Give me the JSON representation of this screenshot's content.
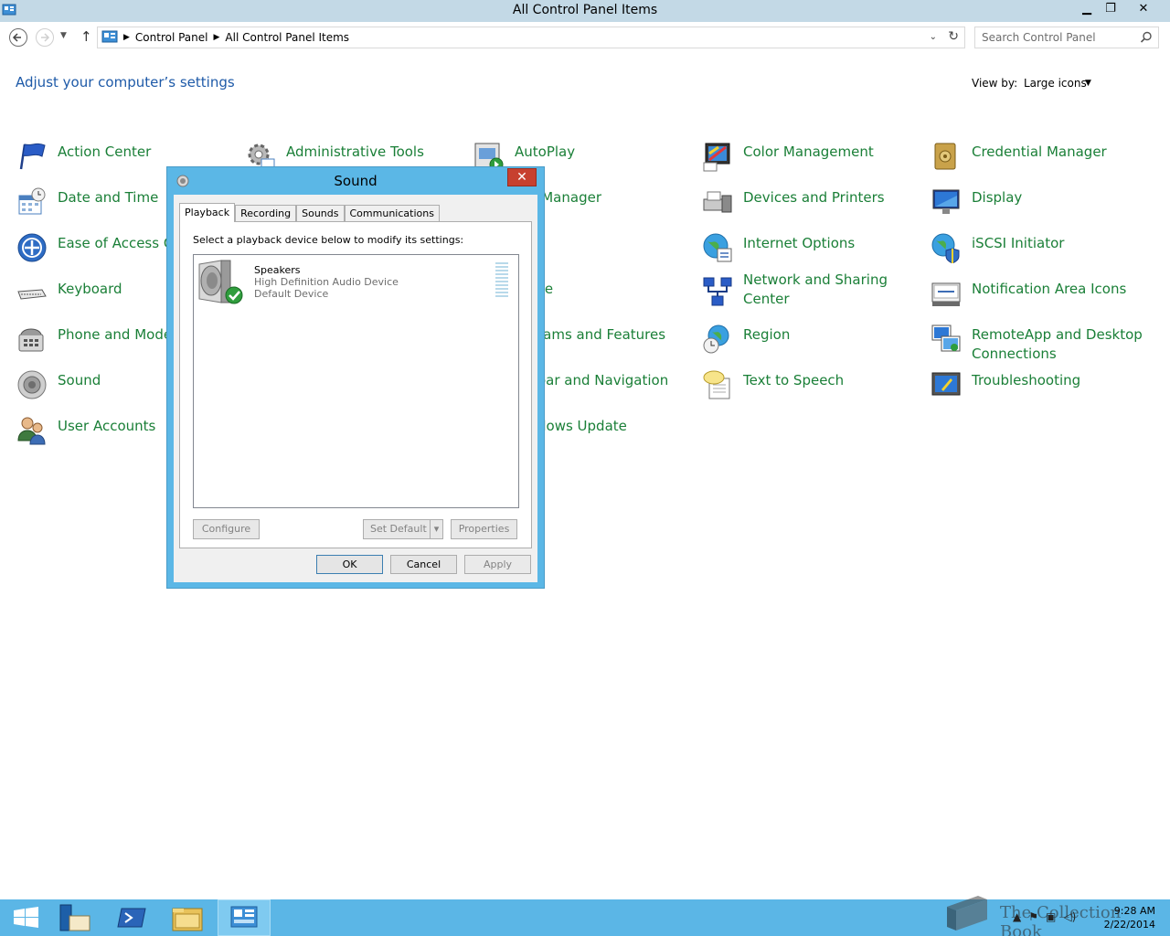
{
  "window": {
    "title": "All Control Panel Items",
    "controls": {
      "minimize": "▁",
      "restore": "❐",
      "close": "✕"
    }
  },
  "address": {
    "crumbs": [
      "Control Panel",
      "All Control Panel Items"
    ],
    "search_placeholder": "Search Control Panel"
  },
  "header": {
    "title": "Adjust your computer’s settings",
    "view_by_label": "View by:",
    "view_by_value": "Large icons"
  },
  "items": {
    "action_center": "Action Center",
    "administrative_tools": "Administrative Tools",
    "autoplay": "AutoPlay",
    "color_management": "Color Management",
    "credential_manager": "Credential Manager",
    "date_and_time": "Date and Time",
    "device_manager_partial": "ce Manager",
    "devices_and_printers": "Devices and Printers",
    "display": "Display",
    "ease_of_access_partial": "Ease of Access Ce",
    "fonts_partial": "s",
    "internet_options": "Internet Options",
    "iscsi_initiator": "iSCSI Initiator",
    "keyboard": "Keyboard",
    "mouse_partial": "se",
    "network_and_sharing": "Network and Sharing Center",
    "notification_area_icons": "Notification Area Icons",
    "phone_and_modem_partial": "Phone and Modem",
    "programs_partial": "rams and Features",
    "region": "Region",
    "remoteapp": "RemoteApp and Desktop Connections",
    "sound": "Sound",
    "taskbar_partial": "oar and Navigation",
    "text_to_speech": "Text to Speech",
    "troubleshooting": "Troubleshooting",
    "user_accounts": "User Accounts",
    "windows_update_partial": "dows Update"
  },
  "sound_dialog": {
    "title": "Sound",
    "tabs": [
      "Playback",
      "Recording",
      "Sounds",
      "Communications"
    ],
    "instruction": "Select a playback device below to modify its settings:",
    "device": {
      "name": "Speakers",
      "description": "High Definition Audio Device",
      "status": "Default Device"
    },
    "buttons": {
      "configure": "Configure",
      "set_default": "Set Default",
      "properties": "Properties",
      "ok": "OK",
      "cancel": "Cancel",
      "apply": "Apply"
    }
  },
  "taskbar": {
    "time": "9:28 AM",
    "date": "2/22/2014"
  },
  "watermark": {
    "text": "The Collection Book"
  },
  "colors": {
    "link_green": "#1a7f37",
    "heading_blue": "#1e5aa8",
    "taskbar_blue": "#5bb6e6",
    "dialog_border": "#5bb7e6",
    "close_red": "#c7402f"
  }
}
